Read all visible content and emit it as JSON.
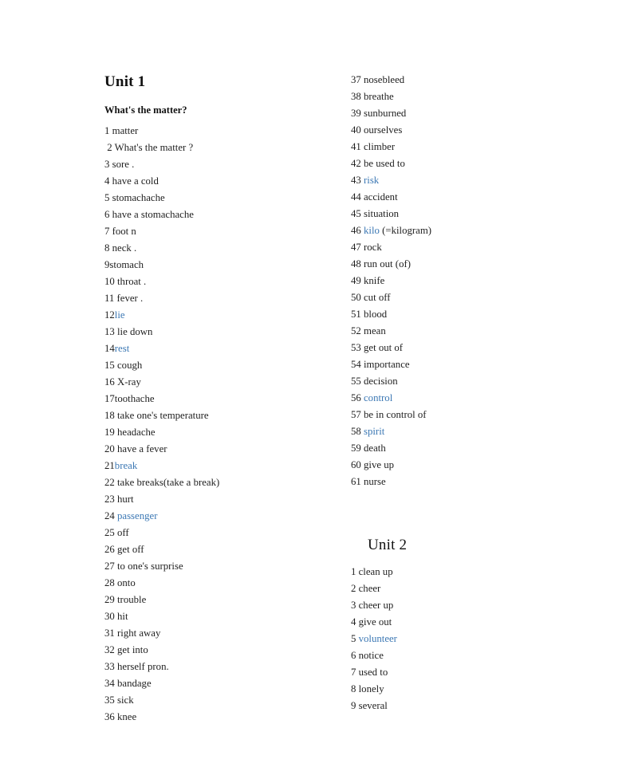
{
  "document": {
    "page_background": "#ffffff",
    "text_color": "#1f1f1f",
    "highlight_color": "#3c78b4"
  },
  "left_column": {
    "unit_title": "Unit 1",
    "section_heading": "What's the matter?",
    "items": [
      {
        "num": "1 ",
        "term": "matter",
        "tail": "",
        "highlight": false
      },
      {
        "num": " 2 ",
        "term": "What's the matter ?",
        "tail": "",
        "highlight": false
      },
      {
        "num": "3 ",
        "term": "sore .",
        "tail": "",
        "highlight": false
      },
      {
        "num": "4 ",
        "term": "have a cold",
        "tail": "",
        "highlight": false
      },
      {
        "num": "5 ",
        "term": "stomachache",
        "tail": "",
        "highlight": false
      },
      {
        "num": "6 ",
        "term": "have a stomachache",
        "tail": "",
        "highlight": false
      },
      {
        "num": "7 ",
        "term": "foot n",
        "tail": "",
        "highlight": false
      },
      {
        "num": "8 ",
        "term": "neck .",
        "tail": "",
        "highlight": false
      },
      {
        "num": "9",
        "term": "stomach",
        "tail": "",
        "highlight": false
      },
      {
        "num": "10 ",
        "term": "throat .",
        "tail": "",
        "highlight": false
      },
      {
        "num": "11 ",
        "term": "fever .",
        "tail": "",
        "highlight": false
      },
      {
        "num": "12",
        "term": "lie",
        "tail": "",
        "highlight": true
      },
      {
        "num": "13 ",
        "term": "lie down",
        "tail": "",
        "highlight": false
      },
      {
        "num": "14",
        "term": "rest",
        "tail": "",
        "highlight": true
      },
      {
        "num": "15 ",
        "term": "cough",
        "tail": "",
        "highlight": false
      },
      {
        "num": "16 ",
        "term": "X-ray",
        "tail": "",
        "highlight": false
      },
      {
        "num": "17",
        "term": "toothache",
        "tail": "",
        "highlight": false
      },
      {
        "num": "18 ",
        "term": "take one's temperature",
        "tail": "",
        "highlight": false
      },
      {
        "num": "19 ",
        "term": "headache",
        "tail": "",
        "highlight": false
      },
      {
        "num": "20 ",
        "term": "have a fever",
        "tail": "",
        "highlight": false
      },
      {
        "num": "21",
        "term": "break",
        "tail": "",
        "highlight": true
      },
      {
        "num": "22 ",
        "term": "take breaks(take a break)",
        "tail": "",
        "highlight": false
      },
      {
        "num": "23 ",
        "term": "hurt",
        "tail": "",
        "highlight": false
      },
      {
        "num": "24 ",
        "term": "passenger",
        "tail": "",
        "highlight": true
      },
      {
        "num": "25 ",
        "term": "off",
        "tail": "",
        "highlight": false
      },
      {
        "num": "26 ",
        "term": "get off",
        "tail": "",
        "highlight": false
      },
      {
        "num": "27 ",
        "term": "to one's surprise",
        "tail": "",
        "highlight": false
      },
      {
        "num": "28 ",
        "term": "onto",
        "tail": "",
        "highlight": false
      },
      {
        "num": "29 ",
        "term": "trouble",
        "tail": "",
        "highlight": false
      },
      {
        "num": "30 ",
        "term": "hit",
        "tail": "",
        "highlight": false
      },
      {
        "num": "31 ",
        "term": "right away",
        "tail": "",
        "highlight": false
      },
      {
        "num": "32 ",
        "term": "get into",
        "tail": "",
        "highlight": false
      },
      {
        "num": "33 ",
        "term": "herself pron.",
        "tail": "",
        "highlight": false
      },
      {
        "num": "34 ",
        "term": "bandage",
        "tail": "",
        "highlight": false
      },
      {
        "num": "35 ",
        "term": "sick",
        "tail": "",
        "highlight": false
      },
      {
        "num": "36 ",
        "term": "knee",
        "tail": "",
        "highlight": false
      }
    ]
  },
  "right_column": {
    "items": [
      {
        "num": "37 ",
        "term": "nosebleed",
        "tail": "",
        "highlight": false
      },
      {
        "num": "38 ",
        "term": "breathe",
        "tail": "",
        "highlight": false
      },
      {
        "num": "39 ",
        "term": "sunburned",
        "tail": "",
        "highlight": false
      },
      {
        "num": "40 ",
        "term": "ourselves",
        "tail": "",
        "highlight": false
      },
      {
        "num": "41 ",
        "term": "climber",
        "tail": "",
        "highlight": false
      },
      {
        "num": "42 ",
        "term": "be used to",
        "tail": "",
        "highlight": false
      },
      {
        "num": "43 ",
        "term": "risk",
        "tail": "",
        "highlight": true
      },
      {
        "num": "44 ",
        "term": "accident",
        "tail": "",
        "highlight": false
      },
      {
        "num": "45 ",
        "term": "situation",
        "tail": "",
        "highlight": false
      },
      {
        "num": "46 ",
        "term": "kilo",
        "tail": " (=kilogram)",
        "highlight": true
      },
      {
        "num": "47 ",
        "term": "rock",
        "tail": "",
        "highlight": false
      },
      {
        "num": "48 ",
        "term": "run out (of)",
        "tail": "",
        "highlight": false
      },
      {
        "num": "49 ",
        "term": "knife",
        "tail": "",
        "highlight": false
      },
      {
        "num": "50 ",
        "term": "cut off",
        "tail": "",
        "highlight": false
      },
      {
        "num": "51 ",
        "term": "blood",
        "tail": "",
        "highlight": false
      },
      {
        "num": "52 ",
        "term": "mean",
        "tail": "",
        "highlight": false
      },
      {
        "num": "53 ",
        "term": "get out of",
        "tail": "",
        "highlight": false
      },
      {
        "num": "54 ",
        "term": "importance",
        "tail": "",
        "highlight": false
      },
      {
        "num": "55 ",
        "term": "decision",
        "tail": "",
        "highlight": false
      },
      {
        "num": "56 ",
        "term": "control",
        "tail": "",
        "highlight": true
      },
      {
        "num": "57 ",
        "term": "be in control of",
        "tail": "",
        "highlight": false
      },
      {
        "num": "58 ",
        "term": "spirit",
        "tail": "",
        "highlight": true
      },
      {
        "num": "59 ",
        "term": "death",
        "tail": "",
        "highlight": false
      },
      {
        "num": "60 ",
        "term": "give up",
        "tail": "",
        "highlight": false
      },
      {
        "num": "61 ",
        "term": "nurse",
        "tail": "",
        "highlight": false
      }
    ],
    "unit_title": "Unit 2",
    "unit2_items": [
      {
        "num": "1 ",
        "term": "clean up",
        "tail": "",
        "highlight": false
      },
      {
        "num": "2 ",
        "term": "cheer",
        "tail": "",
        "highlight": false
      },
      {
        "num": "3 ",
        "term": "cheer up",
        "tail": "",
        "highlight": false
      },
      {
        "num": "4 ",
        "term": "give out",
        "tail": "",
        "highlight": false
      },
      {
        "num": "5 ",
        "term": "volunteer",
        "tail": "",
        "highlight": true
      },
      {
        "num": "6 ",
        "term": "notice",
        "tail": "",
        "highlight": false
      },
      {
        "num": "7 ",
        "term": "used to",
        "tail": "",
        "highlight": false
      },
      {
        "num": "8 ",
        "term": "lonely",
        "tail": "",
        "highlight": false
      },
      {
        "num": "9 ",
        "term": "several",
        "tail": "",
        "highlight": false
      }
    ]
  }
}
